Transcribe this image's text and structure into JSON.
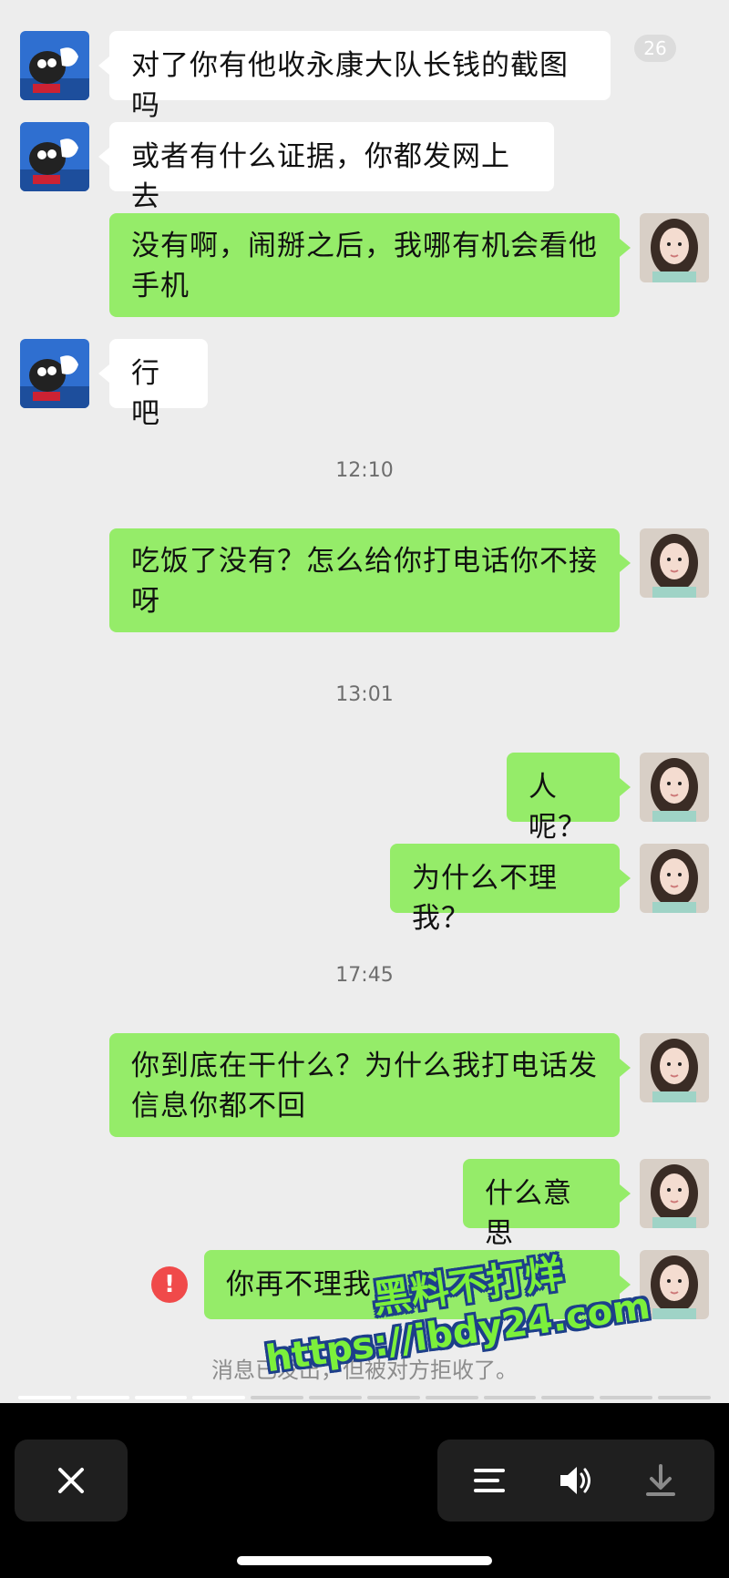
{
  "status": {
    "unread_badge": "26"
  },
  "messages": [
    {
      "text": "对了你有他收永康大队长钱的截图吗"
    },
    {
      "text": "或者有什么证据，你都发网上去"
    },
    {
      "text": "没有啊，闹掰之后，我哪有机会看他手机"
    },
    {
      "text": "行吧"
    },
    {
      "text": "吃饭了没有？怎么给你打电话你不接呀"
    },
    {
      "text": "人呢？"
    },
    {
      "text": "为什么不理我？"
    },
    {
      "text": "你到底在干什么？为什么我打电话发信息你都不回"
    },
    {
      "text": "什么意思"
    },
    {
      "text": "你再不理我"
    }
  ],
  "times": [
    "12:10",
    "13:01",
    "17:45"
  ],
  "error_mark": "!",
  "system_notice": "消息已发出，但被对方拒收了。",
  "watermark": {
    "line1": "黑料不打烊",
    "line2": "https://ibdy24.com"
  },
  "controls": {
    "close": "close-icon",
    "menu": "menu-icon",
    "sound": "speaker-icon",
    "download": "download-icon"
  },
  "colors": {
    "incoming": "#ffffff",
    "outgoing": "#95ec69",
    "error": "#f04a4a"
  }
}
